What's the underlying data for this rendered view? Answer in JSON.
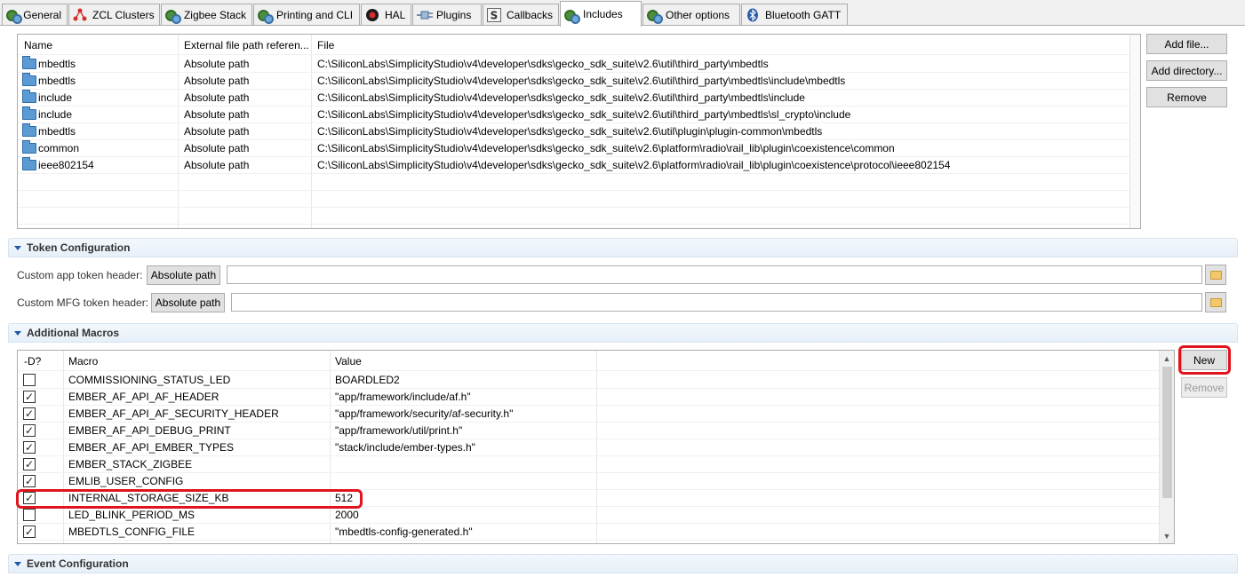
{
  "tabs": [
    {
      "label": "General",
      "icon": "gear-icon"
    },
    {
      "label": "ZCL Clusters",
      "icon": "cluster-icon"
    },
    {
      "label": "Zigbee Stack",
      "icon": "gear-icon"
    },
    {
      "label": "Printing and CLI",
      "icon": "gear-icon"
    },
    {
      "label": "HAL",
      "icon": "hal-icon"
    },
    {
      "label": "Plugins",
      "icon": "plugin-icon"
    },
    {
      "label": "Callbacks",
      "icon": "callbacks-icon"
    },
    {
      "label": "Includes",
      "icon": "gear-icon"
    },
    {
      "label": "Other options",
      "icon": "gear-icon"
    },
    {
      "label": "Bluetooth GATT",
      "icon": "bluetooth-icon"
    }
  ],
  "active_tab": "Includes",
  "includes": {
    "columns": [
      "Name",
      "External file path referen...",
      "File"
    ],
    "rows": [
      {
        "name": "mbedtls",
        "type": "Absolute path",
        "file": "C:\\SiliconLabs\\SimplicityStudio\\v4\\developer\\sdks\\gecko_sdk_suite\\v2.6\\util\\third_party\\mbedtls"
      },
      {
        "name": "mbedtls",
        "type": "Absolute path",
        "file": "C:\\SiliconLabs\\SimplicityStudio\\v4\\developer\\sdks\\gecko_sdk_suite\\v2.6\\util\\third_party\\mbedtls\\include\\mbedtls"
      },
      {
        "name": "include",
        "type": "Absolute path",
        "file": "C:\\SiliconLabs\\SimplicityStudio\\v4\\developer\\sdks\\gecko_sdk_suite\\v2.6\\util\\third_party\\mbedtls\\include"
      },
      {
        "name": "include",
        "type": "Absolute path",
        "file": "C:\\SiliconLabs\\SimplicityStudio\\v4\\developer\\sdks\\gecko_sdk_suite\\v2.6\\util\\third_party\\mbedtls\\sl_crypto\\include"
      },
      {
        "name": "mbedtls",
        "type": "Absolute path",
        "file": "C:\\SiliconLabs\\SimplicityStudio\\v4\\developer\\sdks\\gecko_sdk_suite\\v2.6\\util\\plugin\\plugin-common\\mbedtls"
      },
      {
        "name": "common",
        "type": "Absolute path",
        "file": "C:\\SiliconLabs\\SimplicityStudio\\v4\\developer\\sdks\\gecko_sdk_suite\\v2.6\\platform\\radio\\rail_lib\\plugin\\coexistence\\common"
      },
      {
        "name": "ieee802154",
        "type": "Absolute path",
        "file": "C:\\SiliconLabs\\SimplicityStudio\\v4\\developer\\sdks\\gecko_sdk_suite\\v2.6\\platform\\radio\\rail_lib\\plugin\\coexistence\\protocol\\ieee802154"
      }
    ],
    "buttons": {
      "add_file": "Add file...",
      "add_directory": "Add directory...",
      "remove": "Remove"
    }
  },
  "token_config": {
    "title": "Token Configuration",
    "app_label": "Custom app token header:",
    "app_path_button": "Absolute path",
    "app_value": "",
    "mfg_label": "Custom MFG token header:",
    "mfg_path_button": "Absolute path",
    "mfg_value": ""
  },
  "macros": {
    "title": "Additional Macros",
    "columns": [
      "-D?",
      "Macro",
      "Value"
    ],
    "rows": [
      {
        "checked": false,
        "macro": "COMMISSIONING_STATUS_LED",
        "value": "BOARDLED2"
      },
      {
        "checked": true,
        "macro": "EMBER_AF_API_AF_HEADER",
        "value": "\"app/framework/include/af.h\""
      },
      {
        "checked": true,
        "macro": "EMBER_AF_API_AF_SECURITY_HEADER",
        "value": "\"app/framework/security/af-security.h\""
      },
      {
        "checked": true,
        "macro": "EMBER_AF_API_DEBUG_PRINT",
        "value": "\"app/framework/util/print.h\""
      },
      {
        "checked": true,
        "macro": "EMBER_AF_API_EMBER_TYPES",
        "value": "\"stack/include/ember-types.h\""
      },
      {
        "checked": true,
        "macro": "EMBER_STACK_ZIGBEE",
        "value": ""
      },
      {
        "checked": true,
        "macro": "EMLIB_USER_CONFIG",
        "value": ""
      },
      {
        "checked": true,
        "macro": "INTERNAL_STORAGE_SIZE_KB",
        "value": "512"
      },
      {
        "checked": false,
        "macro": "LED_BLINK_PERIOD_MS",
        "value": "2000"
      },
      {
        "checked": true,
        "macro": "MBEDTLS_CONFIG_FILE",
        "value": "\"mbedtls-config-generated.h\""
      }
    ],
    "buttons": {
      "new": "New",
      "remove": "Remove"
    }
  },
  "event_config": {
    "title": "Event Configuration"
  },
  "colors": {
    "highlight": "#e0141d",
    "section_text": "#333333",
    "folder": "#5b9bd5"
  }
}
